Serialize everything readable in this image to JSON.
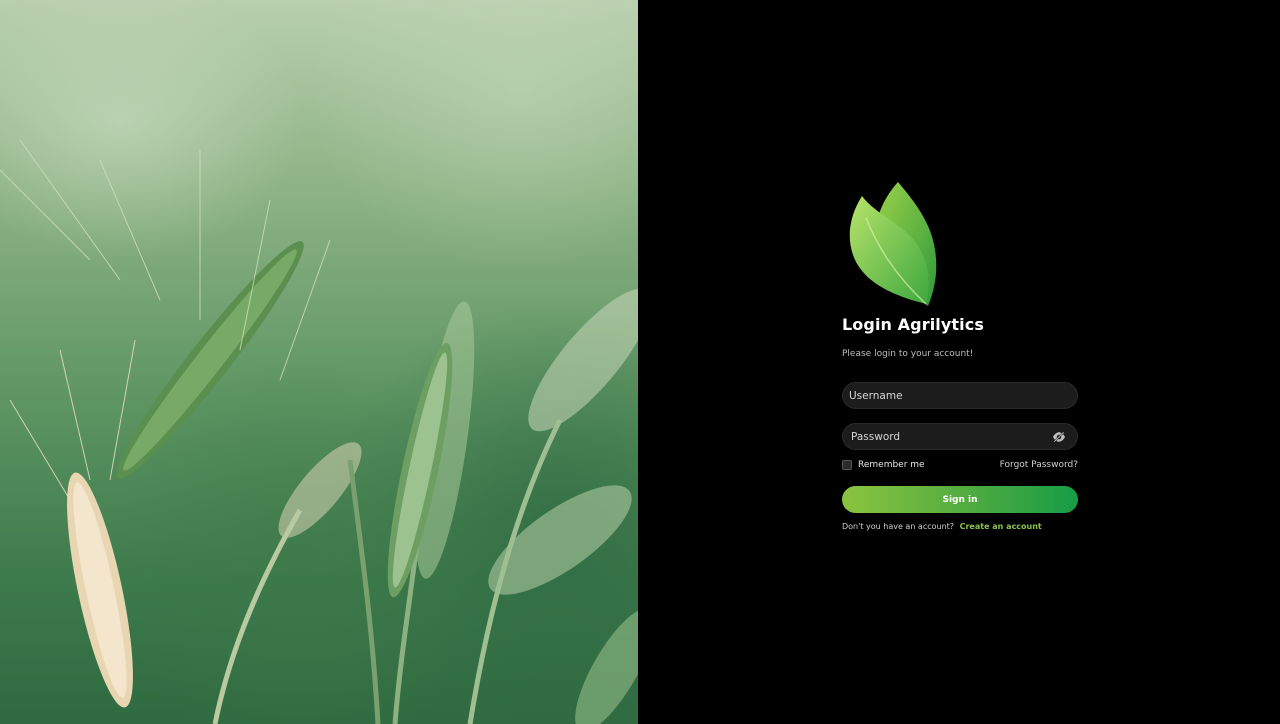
{
  "brand": {
    "logo_icon": "leaf-icon",
    "accent_light": "#8bc43f",
    "accent_dark": "#169c47"
  },
  "login": {
    "title": "Login Agrilytics",
    "subtitle": "Please login to your account!",
    "username_placeholder": "Username",
    "password_placeholder": "Password",
    "password_toggle_icon": "eye-off-icon",
    "remember_label": "Remember me",
    "forgot_label": "Forgot Password?",
    "signin_label": "Sign in",
    "signup_prompt": "Don't you have an account?",
    "signup_link": "Create an account"
  }
}
